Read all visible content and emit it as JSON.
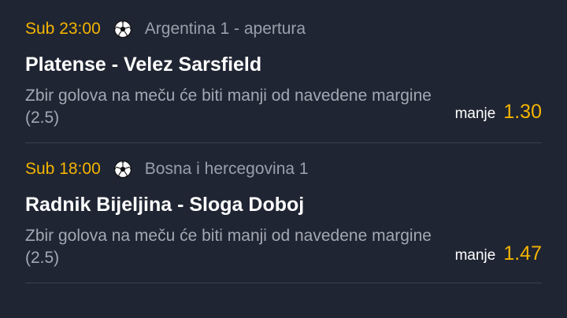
{
  "bets": [
    {
      "time": "Sub 23:00",
      "sport_icon": "soccer-ball-icon",
      "league": "Argentina 1 - apertura",
      "match": "Platense - Velez Sarsfield",
      "market": "Zbir golova na meču će biti manji od navedene margine (2.5)",
      "pick_label": "manje",
      "odd": "1.30"
    },
    {
      "time": "Sub 18:00",
      "sport_icon": "soccer-ball-icon",
      "league": "Bosna i hercegovina 1",
      "match": "Radnik Bijeljina - Sloga Doboj",
      "market": "Zbir golova na meču će biti manji od navedene margine (2.5)",
      "pick_label": "manje",
      "odd": "1.47"
    }
  ],
  "colors": {
    "background": "#1f2532",
    "accent": "#f5b400",
    "muted_text": "#9aa0ab",
    "divider": "#3a4150"
  }
}
